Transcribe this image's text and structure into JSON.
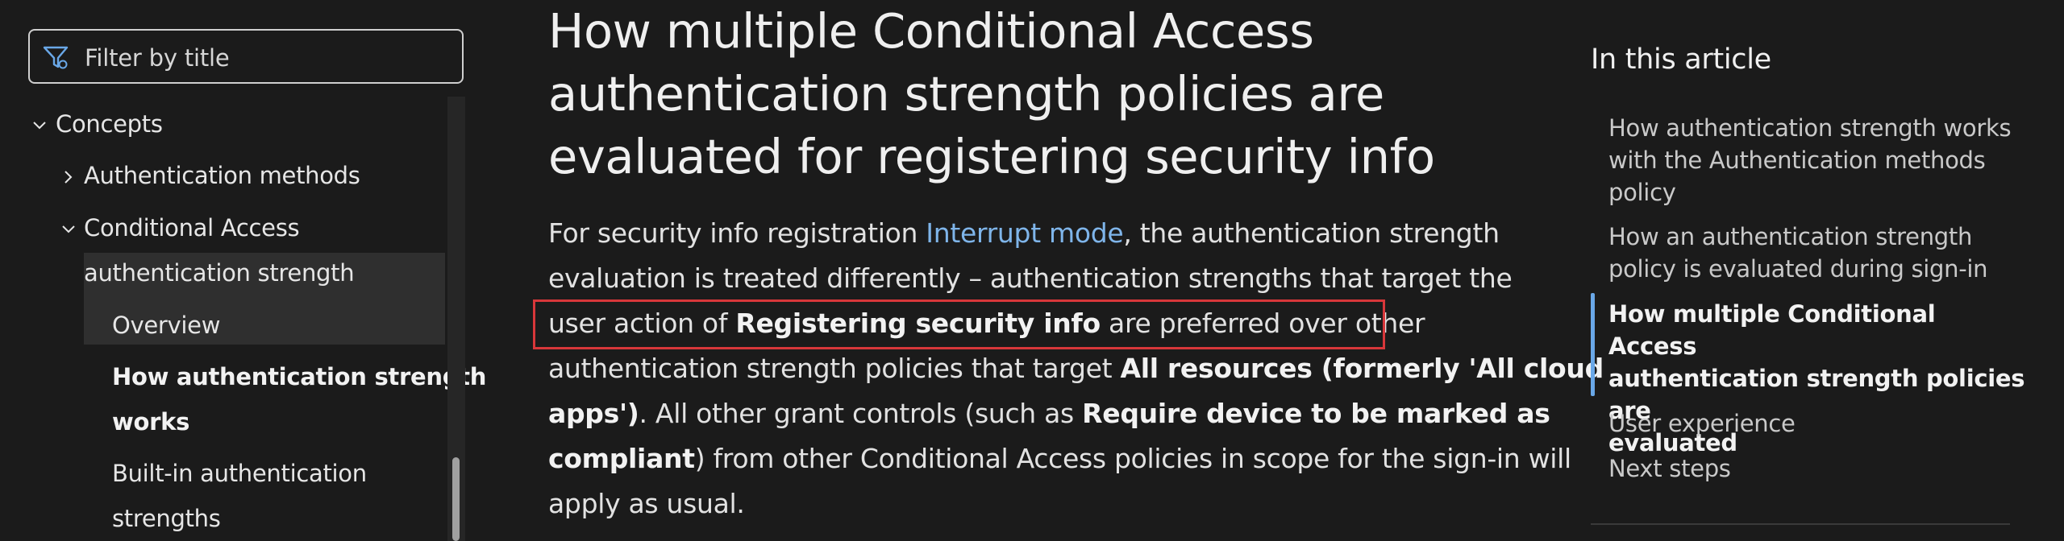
{
  "filter": {
    "placeholder": "Filter by title"
  },
  "nav": {
    "concepts": "Concepts",
    "auth_methods": "Authentication methods",
    "ca_auth_strength_line1": "Conditional Access",
    "ca_auth_strength_line2": "authentication strength",
    "overview": "Overview",
    "how_works_line1": "How authentication strength",
    "how_works_line2": "works",
    "builtin_line1": "Built-in authentication",
    "builtin_line2": "strengths"
  },
  "article": {
    "title_lines": [
      "How multiple Conditional Access",
      "authentication strength policies are",
      "evaluated for registering security info"
    ],
    "para": {
      "l1_a": "For security info registration ",
      "l1_link": "Interrupt mode",
      "l1_b": ", the authentication strength",
      "l2": "evaluation is treated differently – authentication strengths that target the",
      "l3_a": "user action of ",
      "l3_bold": "Registering security info",
      "l3_b": " are preferred over other",
      "l4_a": "authentication strength policies that target ",
      "l4_bold": "All resources (formerly 'All cloud",
      "l5_bold": "apps')",
      "l5_a": ". All other grant controls (such as ",
      "l5_bold2": "Require device to be marked as",
      "l6_bold": "compliant",
      "l6_a": ") from other Conditional Access policies in scope for the sign-in will",
      "l7": "apply as usual."
    }
  },
  "toc": {
    "heading": "In this article",
    "item1": [
      "How authentication strength works",
      "with the Authentication methods",
      "policy"
    ],
    "item2": [
      "How an authentication strength",
      "policy is evaluated during sign-in"
    ],
    "item3": [
      "How multiple Conditional Access",
      "authentication strength policies are",
      "evaluated"
    ],
    "item4": "User experience",
    "item5": "Next steps"
  },
  "colors": {
    "link": "#7fb5ea",
    "highlight_box": "#d8373a",
    "toc_active_bar": "#6aa8e8"
  }
}
